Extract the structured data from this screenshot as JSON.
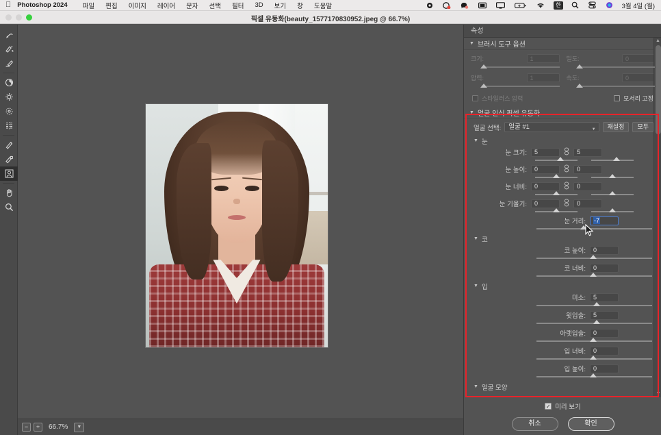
{
  "menubar": {
    "apple_icon": "apple-icon",
    "app_name": "Photoshop 2024",
    "items": [
      "파일",
      "편집",
      "이미지",
      "레이어",
      "문자",
      "선택",
      "필터",
      "3D",
      "보기",
      "창",
      "도움말"
    ],
    "status_icons": [
      "record-icon",
      "screen-share-icon",
      "messages-icon",
      "display-icon",
      "monitor-icon",
      "battery-icon",
      "wifi-icon"
    ],
    "input_source": "한",
    "extra_icons": [
      "search-icon",
      "control-center-icon",
      "siri-icon"
    ],
    "clock": "3월 4일 (월)"
  },
  "titlebar": {
    "document_title": "픽셀 유동화(beauty_1577170830952.jpeg @ 66.7%)"
  },
  "toolbar": {
    "tools": [
      {
        "name": "forward-warp-tool",
        "glyph": "warp"
      },
      {
        "name": "reconstruct-tool",
        "glyph": "reconstruct"
      },
      {
        "name": "smooth-tool",
        "glyph": "smooth"
      },
      {
        "name": "twirl-clockwise-tool",
        "glyph": "twirl"
      },
      {
        "name": "pucker-tool",
        "glyph": "pucker"
      },
      {
        "name": "bloat-tool",
        "glyph": "bloat"
      },
      {
        "name": "push-left-tool",
        "glyph": "pushleft"
      },
      {
        "name": "freeze-mask-tool",
        "glyph": "freeze"
      },
      {
        "name": "thaw-mask-tool",
        "glyph": "thaw"
      },
      {
        "name": "face-tool",
        "glyph": "face"
      },
      {
        "name": "hand-tool",
        "glyph": "hand"
      },
      {
        "name": "zoom-tool",
        "glyph": "zoom"
      }
    ],
    "active_tool_index": 9
  },
  "canvas_status": {
    "zoom_out_label": "−",
    "zoom_in_label": "+",
    "zoom_value": "66.7%",
    "zoom_caret": "chevron-down-icon"
  },
  "panel": {
    "tab_label": "속성",
    "brush_section": {
      "title": "브러시 도구 옵션",
      "fields": [
        {
          "label": "크기:",
          "value": "1",
          "slider_pct": 0
        },
        {
          "label": "밀도:",
          "value": "0",
          "slider_pct": 0
        },
        {
          "label": "압력:",
          "value": "1",
          "slider_pct": 0
        },
        {
          "label": "속도:",
          "value": "0",
          "slider_pct": 0
        }
      ],
      "stylus_checkbox": {
        "label": "스타일러스 압력",
        "checked": false
      },
      "pin_edges_checkbox": {
        "label": "모서리 고정",
        "checked": false
      }
    },
    "face_section": {
      "title": "얼굴 인식 픽셀 유동화",
      "select_label": "얼굴 선택:",
      "selected_face": "얼굴 #1",
      "reset_button": "재설정",
      "all_button": "모두"
    },
    "eyes_section": {
      "title": "눈",
      "rows": [
        {
          "label": "눈 크기:",
          "left": "5",
          "right": "5",
          "left_pct": 60,
          "right_pct": 60,
          "link_icon": "link-icon"
        },
        {
          "label": "눈 높이:",
          "left": "0",
          "right": "0",
          "left_pct": 50,
          "right_pct": 50,
          "link_icon": "link-icon"
        },
        {
          "label": "눈 너비:",
          "left": "0",
          "right": "0",
          "left_pct": 50,
          "right_pct": 50,
          "link_icon": "link-icon"
        },
        {
          "label": "눈 기울기:",
          "left": "0",
          "right": "0",
          "left_pct": 50,
          "right_pct": 50,
          "link_icon": "link-icon"
        }
      ],
      "distance_row": {
        "label": "눈 거리:",
        "value": "-7",
        "slider_pct": 42,
        "focused": true
      }
    },
    "nose_section": {
      "title": "코",
      "rows": [
        {
          "label": "코 높이:",
          "value": "0",
          "slider_pct": 50
        },
        {
          "label": "코 너비:",
          "value": "0",
          "slider_pct": 50
        }
      ]
    },
    "mouth_section": {
      "title": "입",
      "rows": [
        {
          "label": "미소:",
          "value": "5",
          "slider_pct": 53
        },
        {
          "label": "윗입술:",
          "value": "5",
          "slider_pct": 53
        },
        {
          "label": "아랫입술:",
          "value": "0",
          "slider_pct": 50
        },
        {
          "label": "입 너비:",
          "value": "0",
          "slider_pct": 50
        },
        {
          "label": "입 높이:",
          "value": "0",
          "slider_pct": 50
        }
      ]
    },
    "face_shape_section": {
      "title": "얼굴 모양"
    },
    "footer": {
      "preview_label": "미리 보기",
      "preview_checked": true,
      "cancel_button": "취소",
      "ok_button": "확인"
    }
  },
  "annotation": {
    "highlight_color": "#e8232a"
  }
}
